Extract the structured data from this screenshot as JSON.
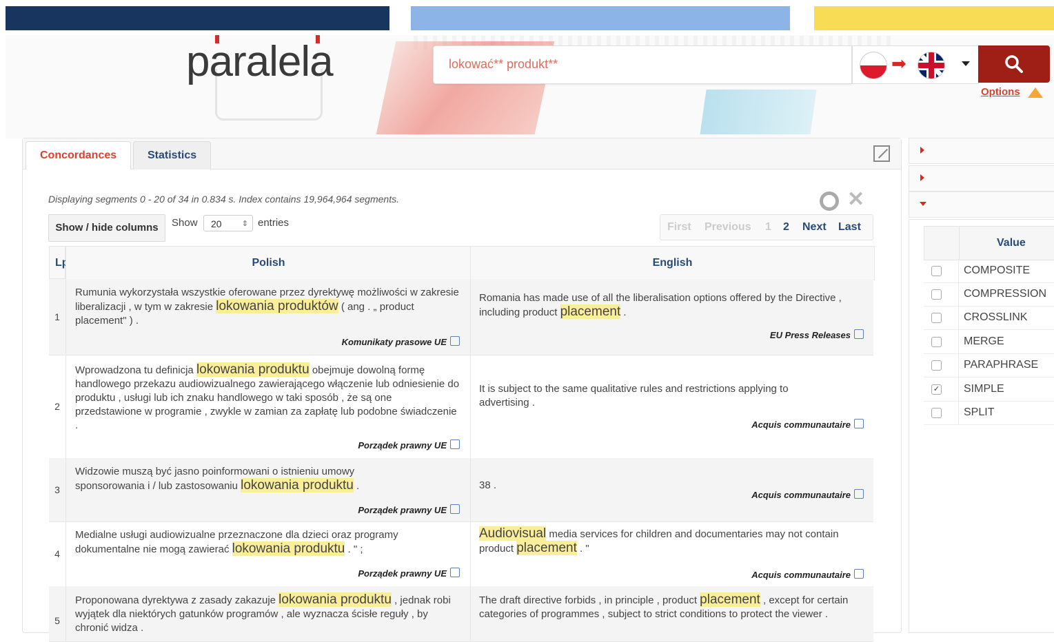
{
  "header": {
    "logo": "paralela",
    "search_value": "lokować** produkt**",
    "search_button": "search-icon",
    "lang_from": "pl-flag-icon",
    "lang_to": "uk-flag-icon",
    "options_label": "Options"
  },
  "tabs": [
    {
      "label": "Concordances",
      "active": true
    },
    {
      "label": "Statistics",
      "active": false
    }
  ],
  "info": "Displaying segments 0 - 20 of 34 in 0.834 s. Index contains 19,964,964 segments.",
  "controls": {
    "show_hide_label": "Show / hide columns",
    "show_label": "Show",
    "entries_value": "20",
    "entries_label": "entries"
  },
  "pager": {
    "first": "First",
    "previous": "Previous",
    "page1": "1",
    "page2": "2",
    "next": "Next",
    "last": "Last"
  },
  "table": {
    "headers": {
      "lp": "Lp",
      "polish": "Polish",
      "english": "English"
    },
    "rows": [
      {
        "lp": "1",
        "pl_pre": "Rumunia wykorzystała wszystkie oferowane przez dyrektywę możliwości w zakresie liberalizacji , w tym w zakresie ",
        "pl_hl": "lokowania produktów",
        "pl_post": " ( ang . „ product placement\" ) .",
        "pl_src": "Komunikaty prasowe UE",
        "en_pre": "Romania has made use of all the liberalisation options offered by the Directive , including product ",
        "en_hl": "placement",
        "en_post": " .",
        "en_src": "EU Press Releases"
      },
      {
        "lp": "2",
        "pl_pre": "Wprowadzona tu definicja ",
        "pl_hl": "lokowania produktu",
        "pl_post": " obejmuje dowolną formę handlowego przekazu audiowizualnego zawierającego włączenie lub odniesienie do produktu , usługi lub ich znaku handlowego w taki sposób , że są one przedstawione w programie , zwykle w zamian za zapłatę lub podobne świadczenie .",
        "pl_src": "Porządek prawny UE",
        "en_pre": "It is subject to the same qualitative rules and restrictions applying to advertising .",
        "en_hl": "",
        "en_post": "",
        "en_src": "Acquis communautaire"
      },
      {
        "lp": "3",
        "pl_pre": "Widzowie muszą być jasno poinformowani o istnieniu umowy sponsorowania i / lub zastosowaniu ",
        "pl_hl": "lokowania produktu",
        "pl_post": " .",
        "pl_src": "Porządek prawny UE",
        "en_pre": "38 .",
        "en_hl": "",
        "en_post": "",
        "en_src": "Acquis communautaire"
      },
      {
        "lp": "4",
        "pl_pre": "Medialne usługi audiowizualne przeznaczone dla dzieci oraz programy dokumentalne nie mogą zawierać ",
        "pl_hl": "lokowania produktu",
        "pl_post": " . \" ;",
        "pl_src": "Porządek prawny UE",
        "en_hl0": "Audiovisual",
        "en_pre": " media services for children and documentaries may not contain product ",
        "en_hl": "placement",
        "en_post": " . \"",
        "en_src": "Acquis communautaire"
      },
      {
        "lp": "5",
        "pl_pre": "Proponowana dyrektywa z zasady zakazuje ",
        "pl_hl": "lokowania produktu",
        "pl_post": " , jednak robi wyjątek dla niektórych gatunków programów , ale wyznacza ścisłe reguły , by chronić widza .",
        "pl_src": "",
        "en_pre": "The draft directive forbids , in principle , product ",
        "en_hl": "placement",
        "en_post": " , except for certain categories of programmes , subject to strict conditions to protect the viewer .",
        "en_src": ""
      }
    ]
  },
  "values_panel": {
    "header": "Value",
    "items": [
      {
        "label": "COMPOSITE",
        "checked": false
      },
      {
        "label": "COMPRESSION",
        "checked": false
      },
      {
        "label": "CROSSLINK",
        "checked": false
      },
      {
        "label": "MERGE",
        "checked": false
      },
      {
        "label": "PARAPHRASE",
        "checked": false
      },
      {
        "label": "SIMPLE",
        "checked": true
      },
      {
        "label": "SPLIT",
        "checked": false
      }
    ]
  },
  "colors": {
    "bar1": "#17355f",
    "bar2": "#8db4e6",
    "bar3": "#f9dc55",
    "accent": "#d9432e",
    "link": "#284a78",
    "highlight": "#fbee9b"
  }
}
